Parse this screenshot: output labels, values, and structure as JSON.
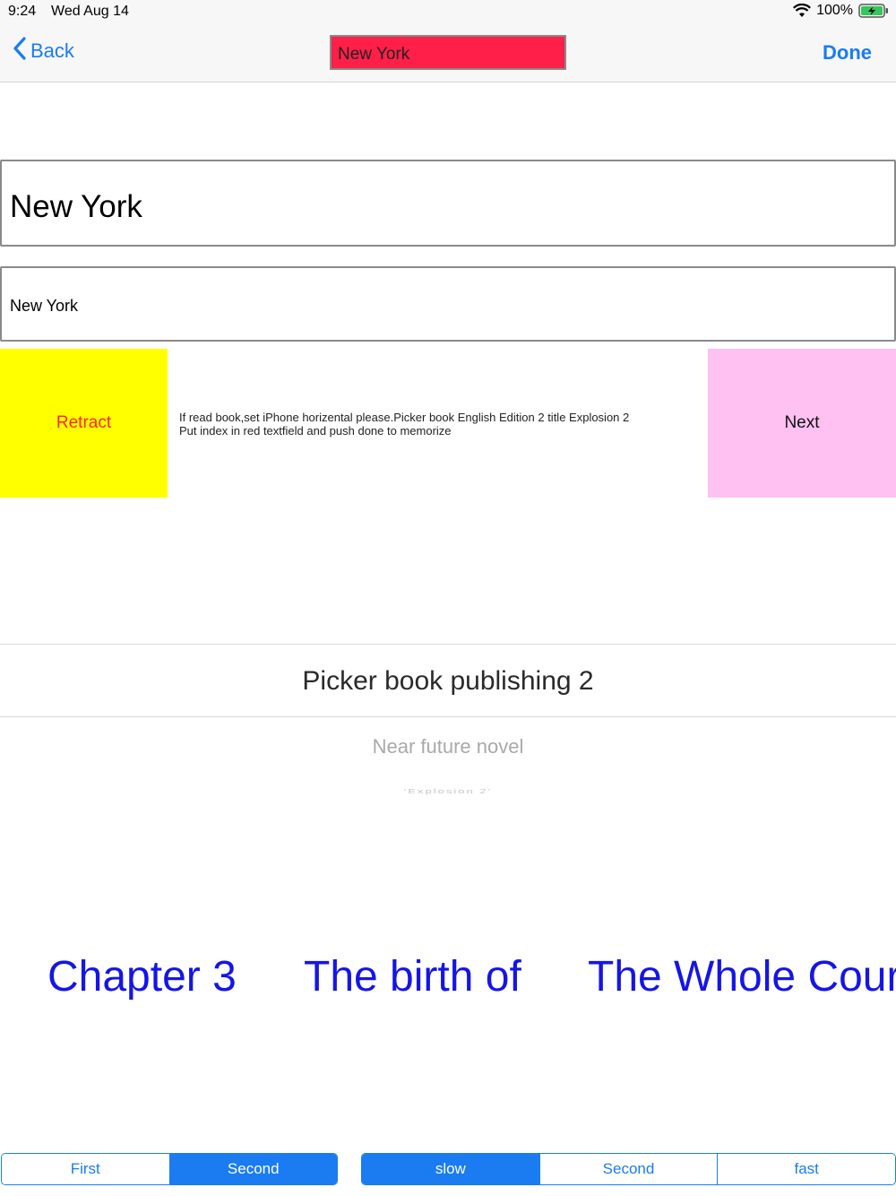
{
  "status_bar": {
    "time": "9:24",
    "date": "Wed Aug 14",
    "battery_percent": "100%",
    "wifi_icon": "wifi-icon",
    "battery_icon": "battery-charging-icon"
  },
  "nav": {
    "back_label": "Back",
    "title_field_value": "New York",
    "done_label": "Done",
    "accent_color": "#1a7cf0",
    "title_field_color": "#ff1f48"
  },
  "fields": {
    "large_value": "New York",
    "small_value": "New York"
  },
  "actions": {
    "retract_label": "Retract",
    "next_label": "Next",
    "instruction": "If read book,set iPhone horizental please.Picker book English Edition 2  title Explosion 2\nPut index in red textfield and push done to memorize",
    "retract_color": "#ffff00",
    "next_color": "#ffc0f2"
  },
  "picker": {
    "selected": "Picker book publishing 2",
    "next": "Near future novel",
    "next2": "'Explosion 2'"
  },
  "chapters": {
    "items": [
      "Chapter 3",
      "The birth of",
      "The Whole Cour"
    ],
    "color": "#1515e8"
  },
  "segment_left": {
    "items": [
      "First",
      "Second"
    ],
    "selected_index": 1
  },
  "segment_right": {
    "items": [
      "slow",
      "Second",
      "fast"
    ],
    "selected_index": 0
  }
}
